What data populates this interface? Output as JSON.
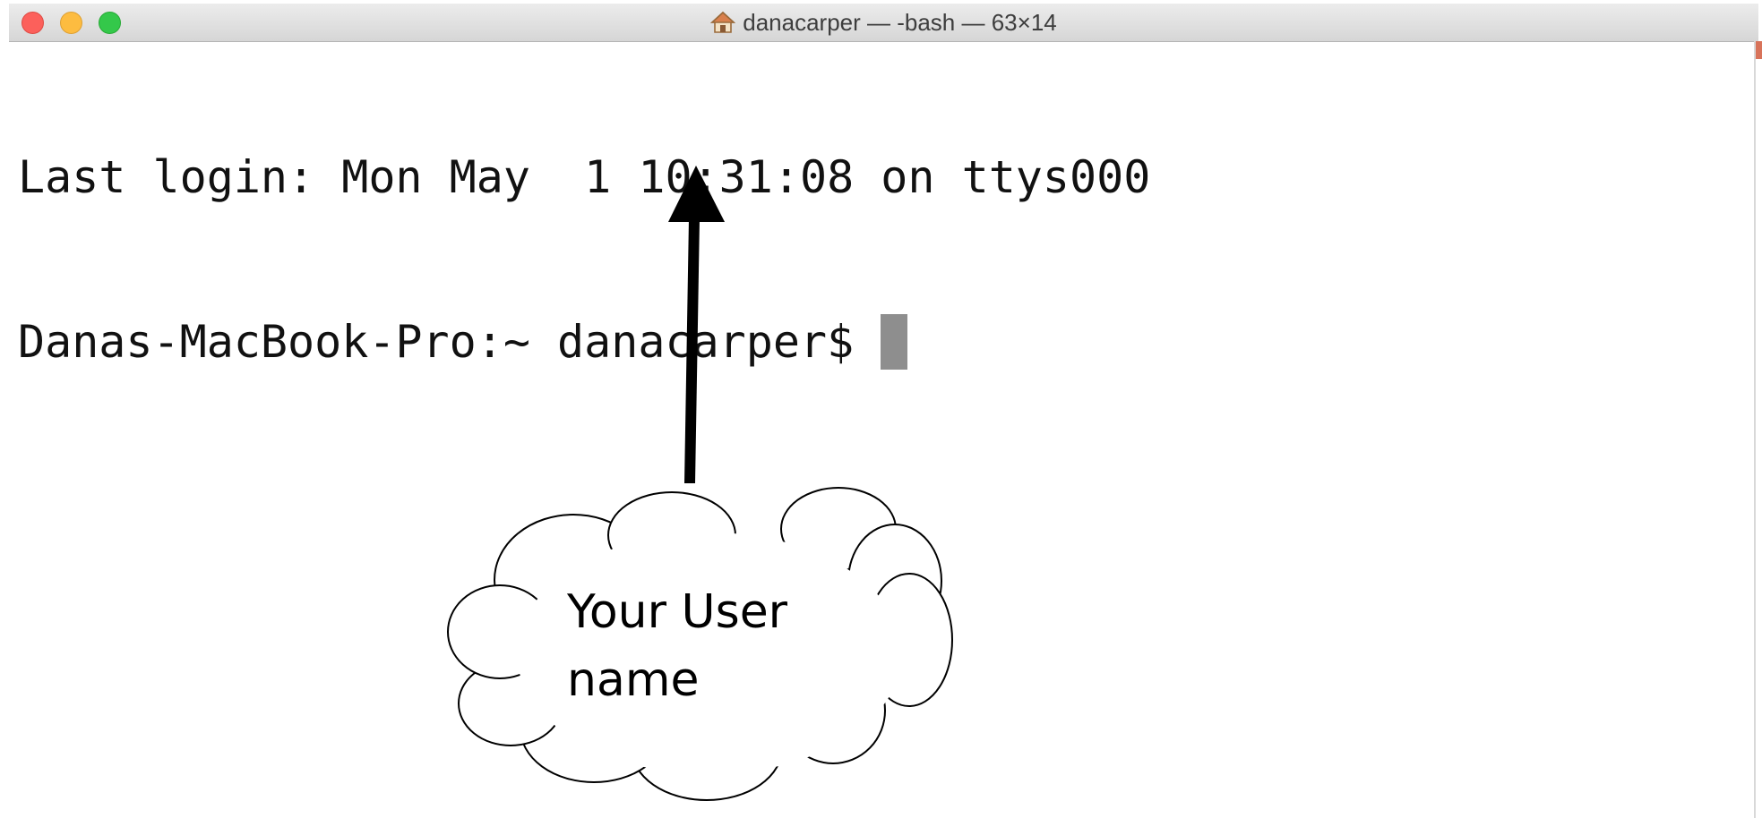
{
  "window": {
    "title": "danacarper — -bash — 63×14",
    "title_icon": "home-icon"
  },
  "terminal": {
    "lines": [
      "Last login: Mon May  1 10:31:08 on ttys000",
      "Danas-MacBook-Pro:~ danacarper$"
    ]
  },
  "annotation": {
    "callout_text_line1": "Your User",
    "callout_text_line2": "name"
  },
  "colors": {
    "close": "#fc605b",
    "minimize": "#fdbc40",
    "maximize": "#34c84a",
    "cursor": "#8e8e8e",
    "text": "#111111"
  }
}
